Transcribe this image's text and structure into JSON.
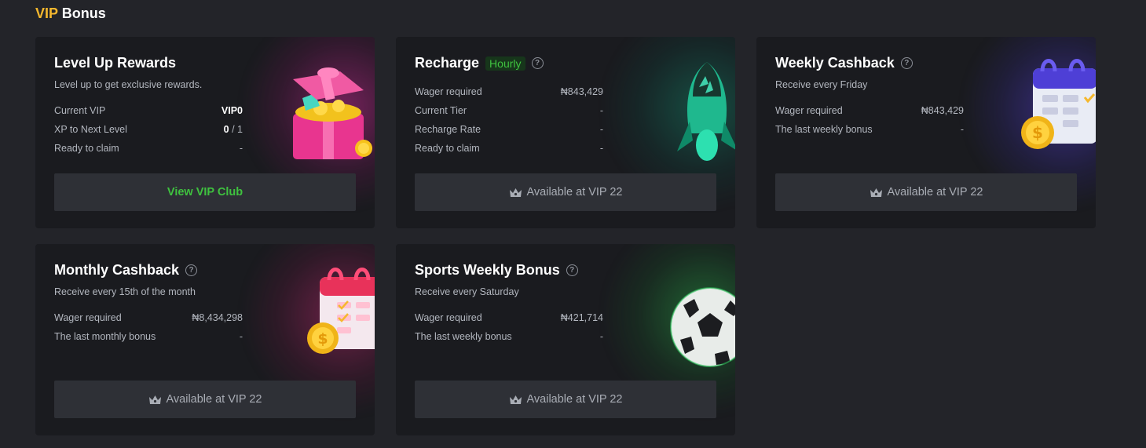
{
  "header": {
    "vip": "VIP",
    "bonus": "Bonus"
  },
  "cards": [
    {
      "title": "Level Up Rewards",
      "subtitle": "Level up to get exclusive rewards.",
      "rows": [
        {
          "label": "Current VIP",
          "value": "VIP0"
        },
        {
          "label": "XP to Next Level",
          "value_main": "0",
          "value_rest": " / 1"
        },
        {
          "label": "Ready to claim",
          "value": "-"
        }
      ],
      "button": "View VIP Club"
    },
    {
      "title": "Recharge",
      "badge": "Hourly",
      "rows": [
        {
          "label": "Wager required",
          "value": "₦843,429"
        },
        {
          "label": "Current Tier",
          "value": "-"
        },
        {
          "label": "Recharge Rate",
          "value": "-"
        },
        {
          "label": "Ready to claim",
          "value": "-"
        }
      ],
      "button": "Available at VIP 22"
    },
    {
      "title": "Weekly Cashback",
      "subtitle": "Receive every Friday",
      "rows": [
        {
          "label": "Wager required",
          "value": "₦843,429"
        },
        {
          "label": "The last weekly bonus",
          "value": "-"
        }
      ],
      "button": "Available at VIP 22"
    },
    {
      "title": "Monthly Cashback",
      "subtitle": "Receive every 15th of the month",
      "rows": [
        {
          "label": "Wager required",
          "value": "₦8,434,298"
        },
        {
          "label": "The last monthly bonus",
          "value": "-"
        }
      ],
      "button": "Available at VIP 22"
    },
    {
      "title": "Sports Weekly Bonus",
      "subtitle": "Receive every Saturday",
      "rows": [
        {
          "label": "Wager required",
          "value": "₦421,714"
        },
        {
          "label": "The last weekly bonus",
          "value": "-"
        }
      ],
      "button": "Available at VIP 22"
    }
  ],
  "icons": {
    "help": "question-circle-icon",
    "crown": "crown-icon",
    "gift": "gift-box-illustration",
    "rocket": "rocket-illustration",
    "calendar": "calendar-coin-illustration",
    "ball": "soccer-ball-illustration"
  },
  "colors": {
    "vip_accent": "#f5b82e",
    "green": "#3fc23f",
    "bg": "#232429",
    "card": "#1a1b1f"
  }
}
